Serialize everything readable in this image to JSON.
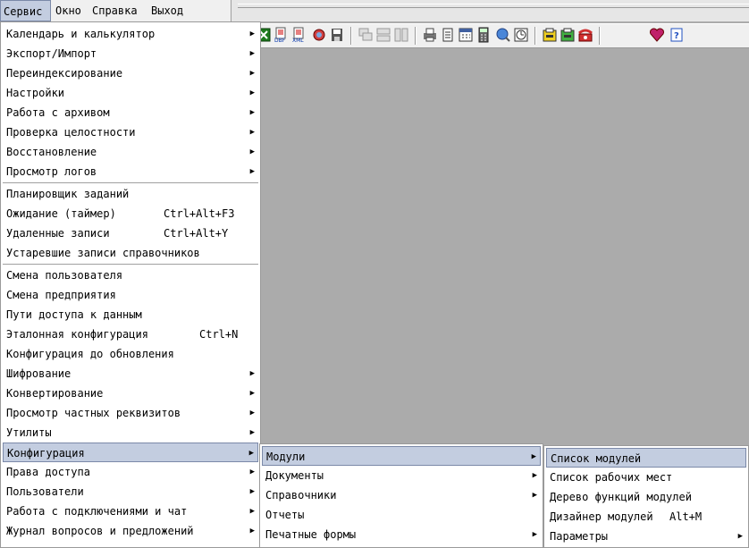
{
  "menubar": {
    "items": [
      "Сервис",
      "Окно",
      "Справка",
      "Выход"
    ]
  },
  "service_menu": {
    "items": [
      {
        "label": "Календарь и калькулятор",
        "submenu": true
      },
      {
        "label": "Экспорт/Импорт",
        "submenu": true
      },
      {
        "label": "Переиндексирование",
        "submenu": true
      },
      {
        "label": "Настройки",
        "submenu": true
      },
      {
        "label": "Работа с архивом",
        "submenu": true
      },
      {
        "label": "Проверка целостности",
        "submenu": true
      },
      {
        "label": "Восстановление",
        "submenu": true
      },
      {
        "label": "Просмотр логов",
        "submenu": true
      },
      {
        "label": "Планировщик заданий"
      },
      {
        "label": "Ожидание (таймер)",
        "shortcut": "Ctrl+Alt+F3"
      },
      {
        "label": "Удаленные записи",
        "shortcut": "Ctrl+Alt+Y"
      },
      {
        "label": "Устаревшие записи справочников"
      },
      {
        "label": "Смена пользователя"
      },
      {
        "label": "Смена предприятия"
      },
      {
        "label": "Пути доступа к данным"
      },
      {
        "label": "Эталонная конфигурация",
        "shortcut": "Ctrl+N"
      },
      {
        "label": "Конфигурация до обновления"
      },
      {
        "label": "Шифрование",
        "submenu": true
      },
      {
        "label": "Конвертирование",
        "submenu": true
      },
      {
        "label": "Просмотр частных реквизитов",
        "submenu": true
      },
      {
        "label": "Утилиты",
        "submenu": true
      },
      {
        "label": "Конфигурация",
        "submenu": true,
        "highlighted": true
      },
      {
        "label": "Права доступа",
        "submenu": true
      },
      {
        "label": "Пользователи",
        "submenu": true
      },
      {
        "label": "Работа с подключениями и чат",
        "submenu": true
      },
      {
        "label": "Журнал вопросов и предложений",
        "submenu": true
      }
    ]
  },
  "config_menu": {
    "items": [
      {
        "label": "Модули",
        "submenu": true,
        "highlighted": true
      },
      {
        "label": "Документы",
        "submenu": true
      },
      {
        "label": "Справочники",
        "submenu": true
      },
      {
        "label": "Отчеты"
      },
      {
        "label": "Печатные формы",
        "submenu": true
      }
    ]
  },
  "modules_menu": {
    "items": [
      {
        "label": "Список модулей",
        "highlighted": true
      },
      {
        "label": "Список рабочих мест"
      },
      {
        "label": "Дерево функций модулей"
      },
      {
        "label": "Дизайнер модулей",
        "shortcut": "Alt+M"
      },
      {
        "label": "Параметры",
        "submenu": true
      }
    ]
  },
  "icons": [
    "excel-export-icon",
    "dbf-export-icon",
    "xml-export-icon",
    "globe-icon",
    "save-icon",
    "cascade-windows-icon",
    "tile-horizontal-icon",
    "tile-vertical-icon",
    "print-icon",
    "document-icon",
    "calendar-icon",
    "calculator-icon",
    "search-globe-icon",
    "clock-icon",
    "archive-yellow-icon",
    "archive-green-icon",
    "phone-icon",
    "favorites-heart-icon",
    "help-icon"
  ],
  "colors": {
    "highlight": "#c3cde0",
    "workspace": "#ababab"
  }
}
